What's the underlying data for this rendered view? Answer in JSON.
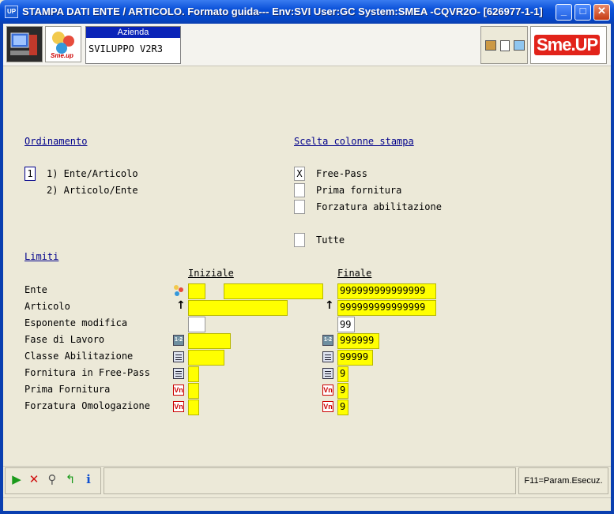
{
  "window": {
    "title": "STAMPA DATI ENTE / ARTICOLO.  Formato guida--- Env:SVI User:GC System:SMEA -CQVR2O- [626977-1-1]",
    "app_icon": "UP",
    "minimize": "_",
    "maximize": "□",
    "close": "✕"
  },
  "toolbar": {
    "azienda_label": "Azienda",
    "azienda_value": "SVILUPPO V2R3",
    "logo_text": "Sme.UP",
    "smeup_small": "Sme.up"
  },
  "ordinamento": {
    "header": "Ordinamento",
    "selected": "1",
    "option1": "1) Ente/Articolo",
    "option2": "2) Articolo/Ente"
  },
  "scelta": {
    "header": "Scelta colonne stampa",
    "free_pass_value": "X",
    "free_pass": "Free-Pass",
    "prima_fornitura": "Prima fornitura",
    "forzatura": "Forzatura abilitazione",
    "tutte": "Tutte"
  },
  "limiti": {
    "header": "Limiti",
    "col_iniziale": "Iniziale",
    "col_finale": "Finale",
    "rows": [
      {
        "label": "Ente",
        "finale": "999999999999999"
      },
      {
        "label": "Articolo",
        "finale": "999999999999999"
      },
      {
        "label": "Esponente modifica",
        "finale": "99"
      },
      {
        "label": "Fase di Lavoro",
        "finale": "999999"
      },
      {
        "label": "Classe Abilitazione",
        "finale": "99999"
      },
      {
        "label": "Fornitura in Free-Pass",
        "finale": "9"
      },
      {
        "label": "Prima Fornitura",
        "finale": "9"
      },
      {
        "label": "Forzatura Omologazione",
        "finale": "9"
      }
    ]
  },
  "icons": {
    "calc_text": "1-2",
    "vn_text": "Vn"
  },
  "bottom": {
    "f11": "F11=Param.Esecuz."
  },
  "colors": {
    "field_yellow": "#FFFF00",
    "header_blue": "#00008B",
    "title_blue": "#0A50D8",
    "logo_red": "#E2231A"
  }
}
